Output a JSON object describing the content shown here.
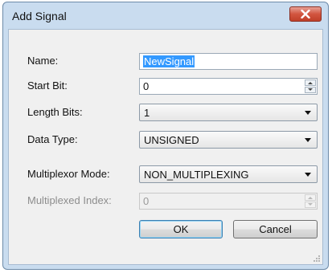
{
  "window": {
    "title": "Add Signal"
  },
  "form": {
    "name": {
      "label": "Name:",
      "value": "NewSignal"
    },
    "start_bit": {
      "label": "Start Bit:",
      "value": "0"
    },
    "length_bits": {
      "label": "Length Bits:",
      "value": "1"
    },
    "data_type": {
      "label": "Data Type:",
      "value": "UNSIGNED"
    },
    "multiplexor_mode": {
      "label": "Multiplexor Mode:",
      "value": "NON_MULTIPLEXING"
    },
    "multiplexed_index": {
      "label": "Multiplexed Index:",
      "value": "0",
      "disabled": true
    }
  },
  "buttons": {
    "ok": "OK",
    "cancel": "Cancel"
  },
  "colors": {
    "close_button": "#c7432e",
    "selection": "#3399ff",
    "frame": "#c9dcef"
  },
  "icons": [
    "close-icon",
    "spin-up-icon",
    "spin-down-icon",
    "dropdown-arrow-icon",
    "resize-grip-icon"
  ]
}
